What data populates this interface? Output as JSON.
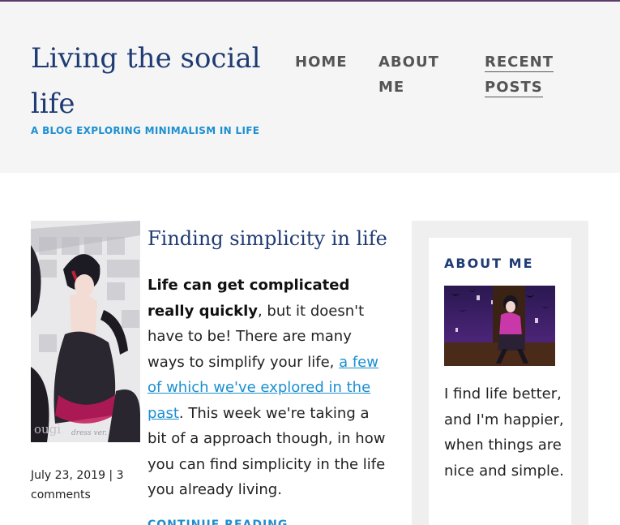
{
  "site": {
    "title": "Living the social life",
    "tagline": "A BLOG EXPLORING MINIMALISM IN LIFE"
  },
  "nav": {
    "items": [
      {
        "label": "HOME"
      },
      {
        "label": "ABOUT ME"
      },
      {
        "label": "RECENT POSTS",
        "active": true
      }
    ]
  },
  "post": {
    "title": "Finding simplicity in life",
    "body_bold": "Life can get complicated really quickly",
    "body_1": ", but it doesn't have to be! There are many ways to simplify your life, ",
    "body_link": "a few of which we've explored in the past",
    "body_2": ". This week we're taking a bit of a approach though, in how you can find simplicity in the life you already living.",
    "date": "July 23, 2019",
    "comments": "3 comments",
    "meta_sep": " | ",
    "continue_label": "CONTINUE READING",
    "thumbnail_watermark": "ougi",
    "thumbnail_caption": "dress ver."
  },
  "sidebar": {
    "widget_title": "ABOUT ME",
    "text": "I find life better, and I'm happier, when things are nice and simple."
  },
  "colors": {
    "accent": "#1b8fd1",
    "title_blue": "#1f3b73",
    "header_bg": "#f5f5f5",
    "topline": "#5b3c6b"
  }
}
